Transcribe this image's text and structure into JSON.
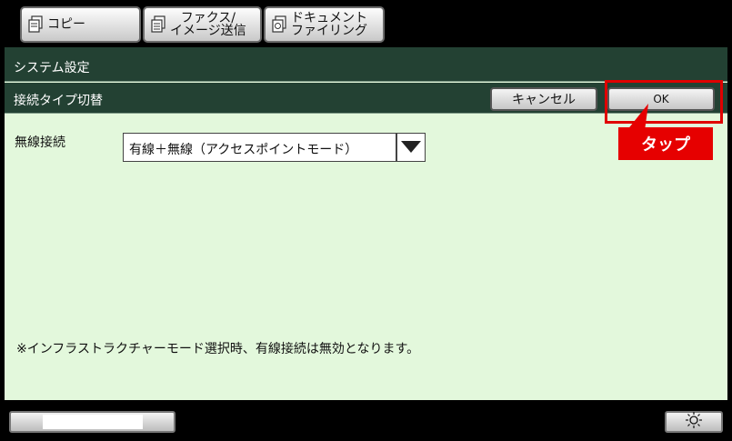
{
  "tabs": [
    {
      "label_line1": "コピー",
      "label_line2": "",
      "icon": "copy-icon"
    },
    {
      "label_line1": "ファクス/",
      "label_line2": "イメージ送信",
      "icon": "fax-icon"
    },
    {
      "label_line1": "ドキュメント",
      "label_line2": "ファイリング",
      "icon": "document-filing-icon"
    }
  ],
  "header": {
    "title": "システム設定",
    "subtitle": "接続タイプ切替"
  },
  "buttons": {
    "cancel": "キャンセル",
    "ok": "OK"
  },
  "annotation": {
    "tap_label": "タップ",
    "color": "#e60000"
  },
  "form": {
    "label": "無線接続",
    "selected_value": "有線＋無線（アクセスポイントモード）"
  },
  "note": "※インフラストラクチャーモード選択時、有線接続は無効となります。",
  "colors": {
    "header_bar": "#234133",
    "panel_bg": "#e3f8dc",
    "highlight": "#e00000"
  },
  "icons": {
    "brightness": "sun-icon"
  }
}
